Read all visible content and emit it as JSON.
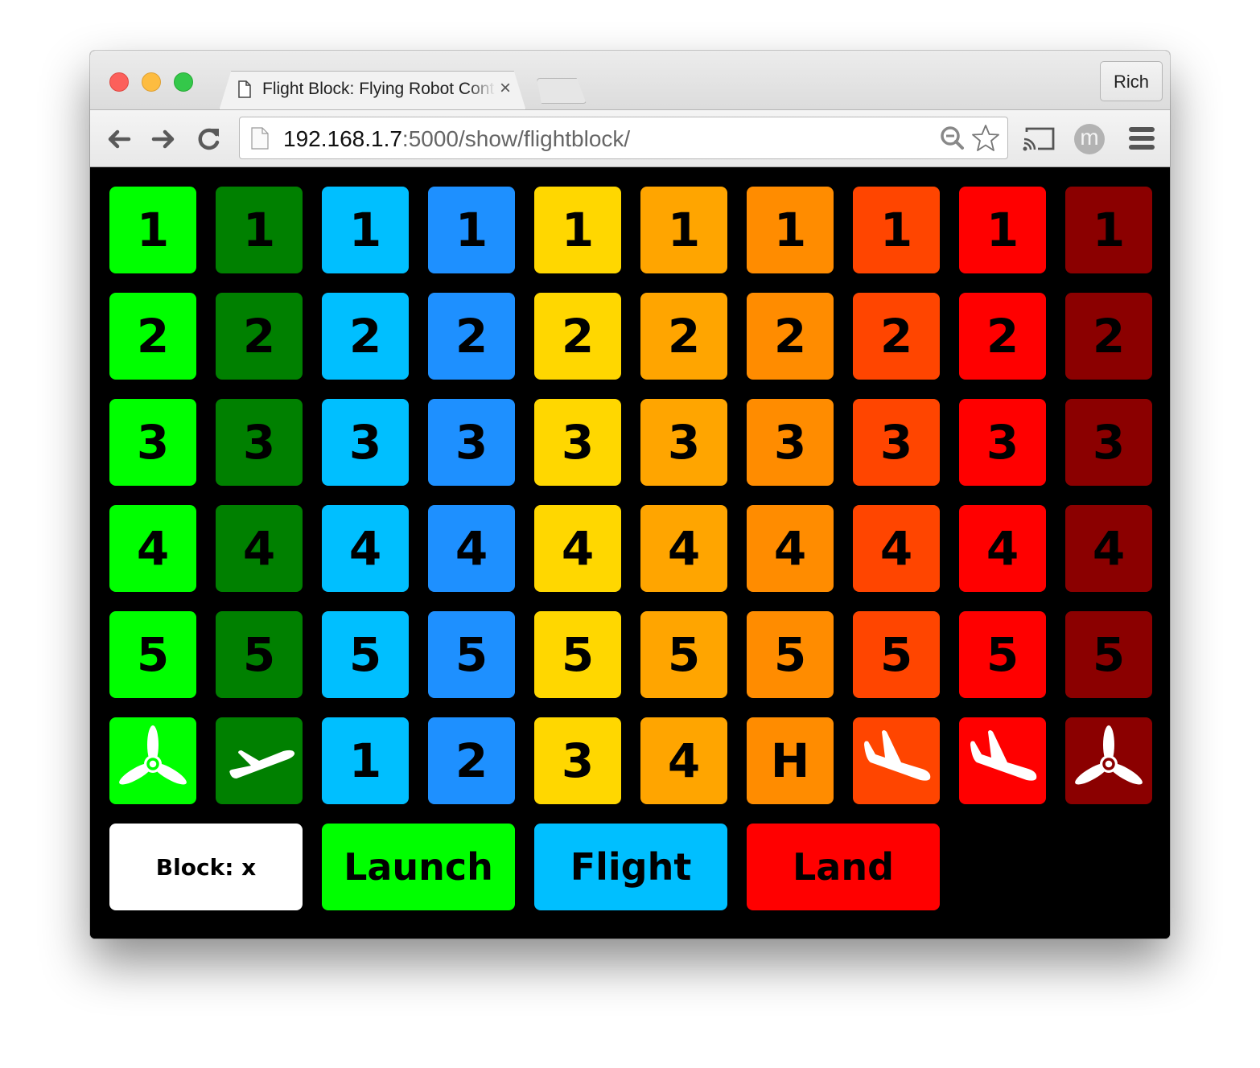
{
  "browser": {
    "tab_title": "Flight Block: Flying Robot Control",
    "tab_close_glyph": "×",
    "profile_name": "Rich",
    "url_host": "192.168.1.7",
    "url_rest": ":5000/show/flightblock/",
    "avatar_letter": "m",
    "icons": [
      "back-icon",
      "forward-icon",
      "reload-icon",
      "page-icon",
      "zoom-out-icon",
      "star-icon",
      "cast-icon",
      "avatar-icon",
      "menu-icon"
    ]
  },
  "colors": {
    "col1": "#00ff00",
    "col2": "#008000",
    "col3": "#00bfff",
    "col4": "#1e90ff",
    "col5": "#ffd700",
    "col6": "#ffa500",
    "col7": "#ff8c00",
    "col8": "#ff4500",
    "col9": "#ff0000",
    "col10": "#8b0000",
    "block_bg": "#ffffff",
    "launch_bg": "#00ff00",
    "flight_bg": "#00bfff",
    "land_bg": "#ff0000"
  },
  "grid": {
    "columns": [
      "#00ff00",
      "#008000",
      "#00bfff",
      "#1e90ff",
      "#ffd700",
      "#ffa500",
      "#ff8c00",
      "#ff4500",
      "#ff0000",
      "#8b0000"
    ],
    "number_rows": [
      "1",
      "2",
      "3",
      "4",
      "5"
    ],
    "action_row": [
      {
        "type": "icon",
        "icon": "propeller-icon",
        "label": "motors-on"
      },
      {
        "type": "icon",
        "icon": "takeoff-icon",
        "label": "takeoff"
      },
      {
        "type": "text",
        "text": "1"
      },
      {
        "type": "text",
        "text": "2"
      },
      {
        "type": "text",
        "text": "3"
      },
      {
        "type": "text",
        "text": "4"
      },
      {
        "type": "text",
        "text": "H"
      },
      {
        "type": "icon",
        "icon": "landing-icon",
        "label": "land"
      },
      {
        "type": "icon",
        "icon": "landing-icon",
        "label": "land"
      },
      {
        "type": "icon",
        "icon": "propeller-icon",
        "label": "motors-off"
      }
    ]
  },
  "bottom": {
    "block_label": "Block: x",
    "launch_label": "Launch",
    "flight_label": "Flight",
    "land_label": "Land"
  }
}
